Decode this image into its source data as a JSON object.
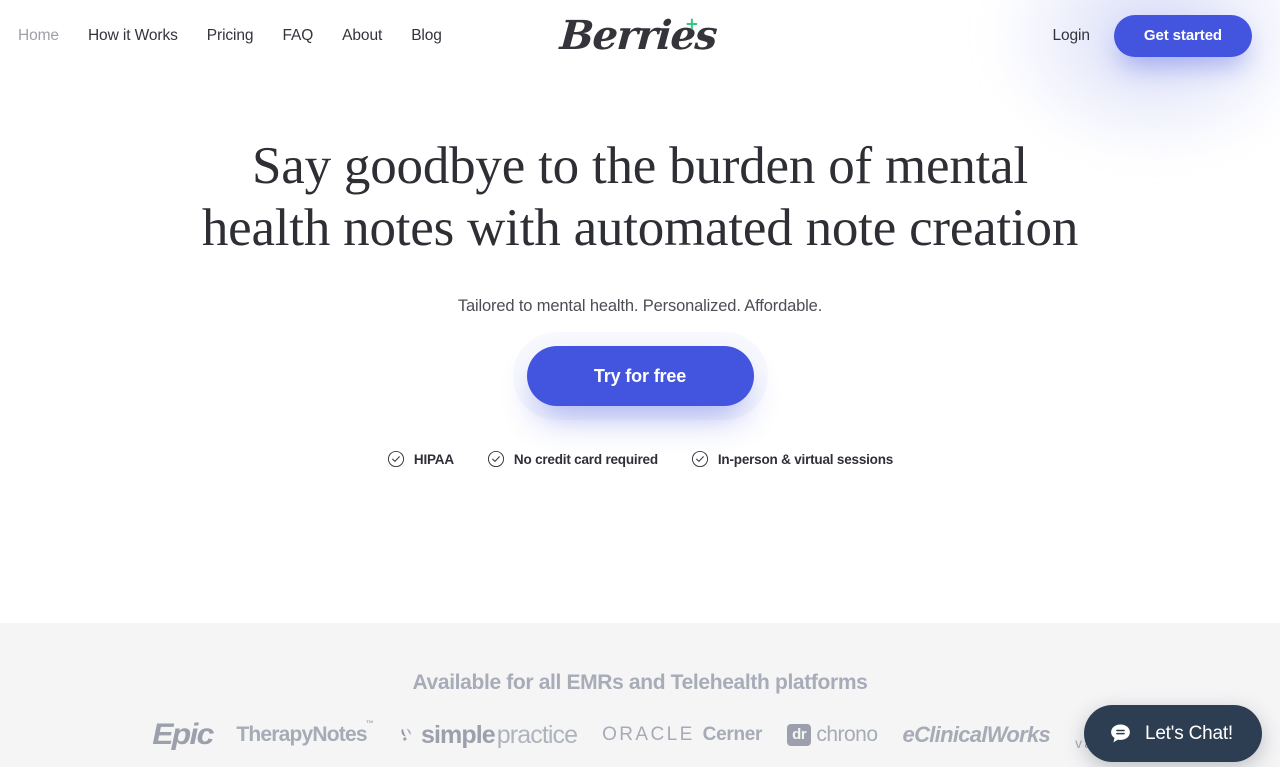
{
  "header": {
    "nav": [
      {
        "label": "Home",
        "active": true
      },
      {
        "label": "How it Works",
        "active": false
      },
      {
        "label": "Pricing",
        "active": false
      },
      {
        "label": "FAQ",
        "active": false
      },
      {
        "label": "About",
        "active": false
      },
      {
        "label": "Blog",
        "active": false
      }
    ],
    "logo_text": "Berries",
    "login_label": "Login",
    "get_started_label": "Get started"
  },
  "hero": {
    "headline_line1": "Say goodbye to the burden of mental",
    "headline_line2": "health notes with automated note creation",
    "subhead": "Tailored to mental health. Personalized. Affordable.",
    "cta_label": "Try for free",
    "features": [
      {
        "label": "HIPAA",
        "icon": "check-circle-icon"
      },
      {
        "label": "No credit card required",
        "icon": "check-circle-icon"
      },
      {
        "label": "In-person & virtual sessions",
        "icon": "check-circle-icon"
      }
    ]
  },
  "emr_section": {
    "title": "Available for all EMRs and Telehealth platforms",
    "logos": [
      {
        "name": "epic",
        "text": "Epic"
      },
      {
        "name": "therapynotes",
        "text": "TherapyNotes",
        "tm": "™"
      },
      {
        "name": "simplepractice",
        "text_bold": "simple",
        "text_light": "practice"
      },
      {
        "name": "oracle-cerner",
        "text_light": "ORACLE",
        "text_bold": "Cerner"
      },
      {
        "name": "drchrono",
        "badge": "dr",
        "text": "chrono"
      },
      {
        "name": "eclinicalworks",
        "text": "eClinicalWorks"
      },
      {
        "name": "valant",
        "text": "vālant"
      }
    ]
  },
  "chat": {
    "label": "Let's Chat!",
    "icon": "chat-bubble-icon"
  },
  "colors": {
    "accent": "#4355de",
    "chat_bg": "#2d3e52",
    "emr_bg": "#f5f5f6",
    "logo_spark": "#35c77f",
    "muted": "#a6abb6"
  }
}
